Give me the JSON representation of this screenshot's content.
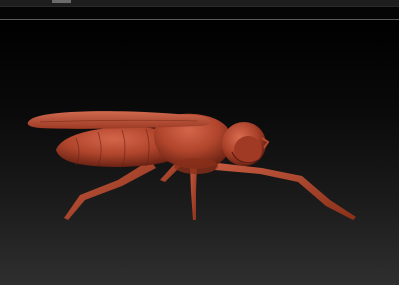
{
  "app": {
    "name": "",
    "viewport_background": [
      "#000000",
      "#2f2f2f"
    ]
  },
  "model": {
    "subject": "fly-sculpt",
    "material_color": "#b8482e",
    "highlight_color": "#d96a4c",
    "shadow_color": "#5e1d10"
  }
}
